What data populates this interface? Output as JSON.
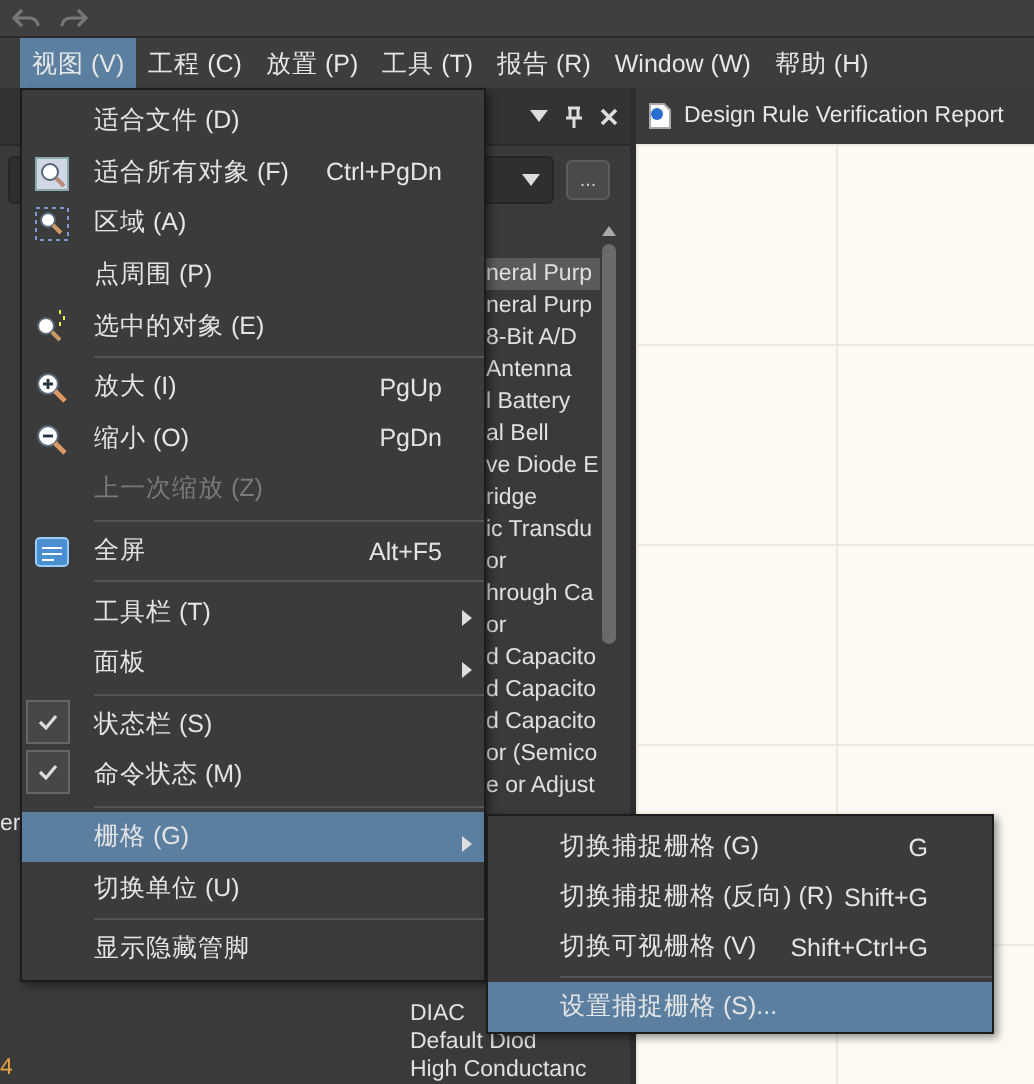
{
  "menubar": [
    {
      "label": "视图 (V)",
      "selected": true
    },
    {
      "label": "工程 (C)",
      "selected": false
    },
    {
      "label": "放置 (P)",
      "selected": false
    },
    {
      "label": "工具 (T)",
      "selected": false
    },
    {
      "label": "报告 (R)",
      "selected": false
    },
    {
      "label": "Window (W)",
      "selected": false
    },
    {
      "label": "帮助 (H)",
      "selected": false
    }
  ],
  "panel": {
    "button": "...",
    "list_above": [
      {
        "text": "neral Purp",
        "selected": true
      },
      {
        "text": "neral Purp",
        "selected": false
      },
      {
        "text": "8-Bit A/D",
        "selected": false
      },
      {
        "text": "Antenna",
        "selected": false
      },
      {
        "text": "l Battery",
        "selected": false
      },
      {
        "text": "al Bell",
        "selected": false
      },
      {
        "text": "ve Diode E",
        "selected": false
      },
      {
        "text": "ridge",
        "selected": false
      },
      {
        "text": "ic Transdu",
        "selected": false
      },
      {
        "text": "or",
        "selected": false
      },
      {
        "text": "hrough Ca",
        "selected": false
      },
      {
        "text": "or",
        "selected": false
      },
      {
        "text": "d Capacito",
        "selected": false
      },
      {
        "text": "d Capacito",
        "selected": false
      },
      {
        "text": "d Capacito",
        "selected": false
      },
      {
        "text": "or (Semico",
        "selected": false
      },
      {
        "text": "e or Adjust",
        "selected": false
      }
    ],
    "list_below": [
      {
        "text": "DIAC",
        "selected": false
      },
      {
        "text": "Default Diod",
        "selected": false
      },
      {
        "text": "High Conductanc",
        "selected": false
      }
    ],
    "edge_texts": [
      "er",
      "4"
    ]
  },
  "document_tab": {
    "title": "Design Rule Verification Report"
  },
  "view_menu": [
    {
      "kind": "item",
      "label": "适合文件 (D)",
      "checked": false,
      "disabled": false,
      "submenu": false,
      "selected": false
    },
    {
      "kind": "item",
      "label": "适合所有对象 (F)",
      "shortcut": "Ctrl+PgDn",
      "checked": false,
      "disabled": false,
      "submenu": false,
      "selected": false
    },
    {
      "kind": "item",
      "label": "区域 (A)",
      "checked": false,
      "disabled": false,
      "submenu": false,
      "selected": false
    },
    {
      "kind": "item",
      "label": "点周围 (P)",
      "checked": false,
      "disabled": false,
      "submenu": false,
      "selected": false
    },
    {
      "kind": "item",
      "label": "选中的对象 (E)",
      "checked": false,
      "disabled": false,
      "submenu": false,
      "selected": false
    },
    {
      "kind": "separator"
    },
    {
      "kind": "item",
      "label": "放大 (I)",
      "shortcut": "PgUp",
      "checked": false,
      "disabled": false,
      "submenu": false,
      "selected": false
    },
    {
      "kind": "item",
      "label": "缩小 (O)",
      "shortcut": "PgDn",
      "checked": false,
      "disabled": false,
      "submenu": false,
      "selected": false
    },
    {
      "kind": "item",
      "label": "上一次缩放 (Z)",
      "checked": false,
      "disabled": true,
      "submenu": false,
      "selected": false
    },
    {
      "kind": "separator"
    },
    {
      "kind": "item",
      "label": "全屏",
      "shortcut": "Alt+F5",
      "checked": false,
      "disabled": false,
      "submenu": false,
      "selected": false
    },
    {
      "kind": "separator"
    },
    {
      "kind": "item",
      "label": "工具栏 (T)",
      "checked": false,
      "disabled": false,
      "submenu": true,
      "selected": false
    },
    {
      "kind": "item",
      "label": "面板",
      "checked": false,
      "disabled": false,
      "submenu": true,
      "selected": false
    },
    {
      "kind": "separator"
    },
    {
      "kind": "item",
      "label": "状态栏 (S)",
      "checked": true,
      "disabled": false,
      "submenu": false,
      "selected": false
    },
    {
      "kind": "item",
      "label": "命令状态 (M)",
      "checked": true,
      "disabled": false,
      "submenu": false,
      "selected": false
    },
    {
      "kind": "separator"
    },
    {
      "kind": "item",
      "label": "栅格 (G)",
      "checked": false,
      "disabled": false,
      "submenu": true,
      "selected": true
    },
    {
      "kind": "item",
      "label": "切换单位 (U)",
      "checked": false,
      "disabled": false,
      "submenu": false,
      "selected": false
    },
    {
      "kind": "separator"
    },
    {
      "kind": "item",
      "label": "显示隐藏管脚",
      "checked": false,
      "disabled": false,
      "submenu": false,
      "selected": false
    }
  ],
  "grid_submenu": [
    {
      "kind": "item",
      "label": "切换捕捉栅格 (G)",
      "shortcut": "G",
      "checked": false,
      "disabled": false,
      "submenu": false,
      "selected": false
    },
    {
      "kind": "item",
      "label": "切换捕捉栅格 (反向) (R)",
      "shortcut": "Shift+G",
      "checked": false,
      "disabled": false,
      "submenu": false,
      "selected": false
    },
    {
      "kind": "item",
      "label": "切换可视栅格 (V)",
      "shortcut": "Shift+Ctrl+G",
      "checked": false,
      "disabled": false,
      "submenu": false,
      "selected": false
    },
    {
      "kind": "separator"
    },
    {
      "kind": "item",
      "label": "设置捕捉栅格 (S)...",
      "checked": false,
      "disabled": false,
      "submenu": false,
      "selected": true
    }
  ]
}
